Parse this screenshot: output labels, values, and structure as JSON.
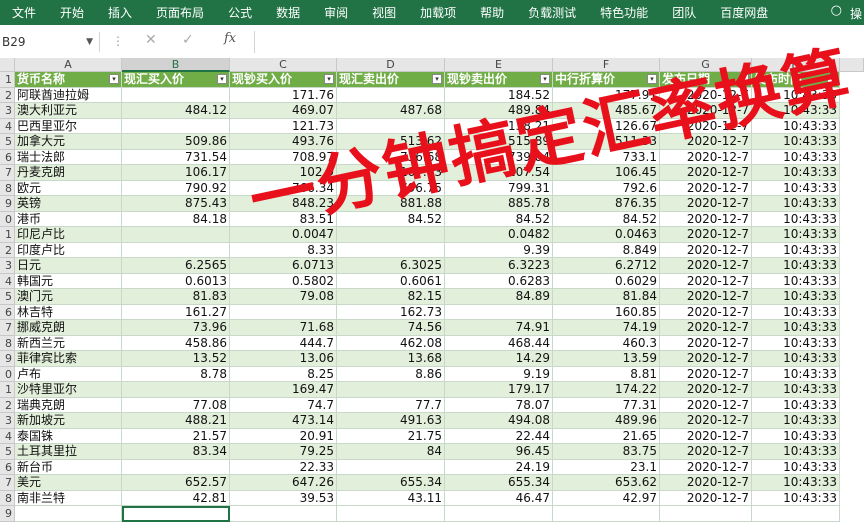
{
  "ribbon": {
    "tabs": [
      "文件",
      "开始",
      "插入",
      "页面布局",
      "公式",
      "数据",
      "审阅",
      "视图",
      "加载项",
      "帮助",
      "负载测试",
      "特色功能",
      "团队",
      "百度网盘"
    ],
    "more_label": "操",
    "bg_color": "#217346"
  },
  "formula_bar": {
    "name_box": "B29",
    "fx_label": "fx",
    "value": ""
  },
  "columns": [
    "A",
    "B",
    "C",
    "D",
    "E",
    "F",
    "G",
    "H"
  ],
  "table": {
    "headers": [
      "货币名称",
      "现汇买入价",
      "现钞买入价",
      "现汇卖出价",
      "现钞卖出价",
      "中行折算价",
      "发布日期",
      "发布时间"
    ],
    "rows": [
      [
        "阿联酋迪拉姆",
        "",
        "171.76",
        "",
        "184.52",
        "177.91",
        "2020-12-7",
        "10:43:33"
      ],
      [
        "澳大利亚元",
        "484.12",
        "469.07",
        "487.68",
        "489.84",
        "485.67",
        "2020-12-7",
        "10:43:33"
      ],
      [
        "巴西里亚尔",
        "",
        "121.73",
        "",
        "138.21",
        "126.67",
        "2020-12-7",
        "10:43:33"
      ],
      [
        "加拿大元",
        "509.86",
        "493.76",
        "513.62",
        "515.89",
        "511.33",
        "2020-12-7",
        "10:43:33"
      ],
      [
        "瑞士法郎",
        "731.54",
        "708.97",
        "736.68",
        "739.84",
        "733.1",
        "2020-12-7",
        "10:43:33"
      ],
      [
        "丹麦克朗",
        "106.17",
        "102.9",
        "107.03",
        "107.54",
        "106.45",
        "2020-12-7",
        "10:43:33"
      ],
      [
        "欧元",
        "790.92",
        "766.34",
        "796.75",
        "799.31",
        "792.6",
        "2020-12-7",
        "10:43:33"
      ],
      [
        "英镑",
        "875.43",
        "848.23",
        "881.88",
        "885.78",
        "876.35",
        "2020-12-7",
        "10:43:33"
      ],
      [
        "港币",
        "84.18",
        "83.51",
        "84.52",
        "84.52",
        "84.52",
        "2020-12-7",
        "10:43:33"
      ],
      [
        "印尼卢比",
        "",
        "0.0047",
        "",
        "0.0482",
        "0.0463",
        "2020-12-7",
        "10:43:33"
      ],
      [
        "印度卢比",
        "",
        "8.33",
        "",
        "9.39",
        "8.849",
        "2020-12-7",
        "10:43:33"
      ],
      [
        "日元",
        "6.2565",
        "6.0713",
        "6.3025",
        "6.3223",
        "6.2712",
        "2020-12-7",
        "10:43:33"
      ],
      [
        "韩国元",
        "0.6013",
        "0.5802",
        "0.6061",
        "0.6283",
        "0.6029",
        "2020-12-7",
        "10:43:33"
      ],
      [
        "澳门元",
        "81.83",
        "79.08",
        "82.15",
        "84.89",
        "81.84",
        "2020-12-7",
        "10:43:33"
      ],
      [
        "林吉特",
        "161.27",
        "",
        "162.73",
        "",
        "160.85",
        "2020-12-7",
        "10:43:33"
      ],
      [
        "挪威克朗",
        "73.96",
        "71.68",
        "74.56",
        "74.91",
        "74.19",
        "2020-12-7",
        "10:43:33"
      ],
      [
        "新西兰元",
        "458.86",
        "444.7",
        "462.08",
        "468.44",
        "460.3",
        "2020-12-7",
        "10:43:33"
      ],
      [
        "菲律宾比索",
        "13.52",
        "13.06",
        "13.68",
        "14.29",
        "13.59",
        "2020-12-7",
        "10:43:33"
      ],
      [
        "卢布",
        "8.78",
        "8.25",
        "8.86",
        "9.19",
        "8.81",
        "2020-12-7",
        "10:43:33"
      ],
      [
        "沙特里亚尔",
        "",
        "169.47",
        "",
        "179.17",
        "174.22",
        "2020-12-7",
        "10:43:33"
      ],
      [
        "瑞典克朗",
        "77.08",
        "74.7",
        "77.7",
        "78.07",
        "77.31",
        "2020-12-7",
        "10:43:33"
      ],
      [
        "新加坡元",
        "488.21",
        "473.14",
        "491.63",
        "494.08",
        "489.96",
        "2020-12-7",
        "10:43:33"
      ],
      [
        "泰国铢",
        "21.57",
        "20.91",
        "21.75",
        "22.44",
        "21.65",
        "2020-12-7",
        "10:43:33"
      ],
      [
        "土耳其里拉",
        "83.34",
        "79.25",
        "84",
        "96.45",
        "83.75",
        "2020-12-7",
        "10:43:33"
      ],
      [
        "新台币",
        "",
        "22.33",
        "",
        "24.19",
        "23.1",
        "2020-12-7",
        "10:43:33"
      ],
      [
        "美元",
        "652.57",
        "647.26",
        "655.34",
        "655.34",
        "653.62",
        "2020-12-7",
        "10:43:33"
      ],
      [
        "南非兰特",
        "42.81",
        "39.53",
        "43.11",
        "46.47",
        "42.97",
        "2020-12-7",
        "10:43:33"
      ]
    ]
  },
  "row_numbers": [
    "1",
    "2",
    "3",
    "4",
    "5",
    "6",
    "7",
    "8",
    "9",
    "0",
    "1",
    "2",
    "3",
    "4",
    "5",
    "6",
    "7",
    "8",
    "9",
    "0",
    "1",
    "2",
    "3",
    "4",
    "5",
    "6",
    "7",
    "8",
    "9"
  ],
  "overlay_title": "一分钟搞定汇率换算",
  "colors": {
    "header_green": "#70ad47",
    "band": "#e2efda",
    "accent": "#217346",
    "title_red": "#e8101a"
  }
}
